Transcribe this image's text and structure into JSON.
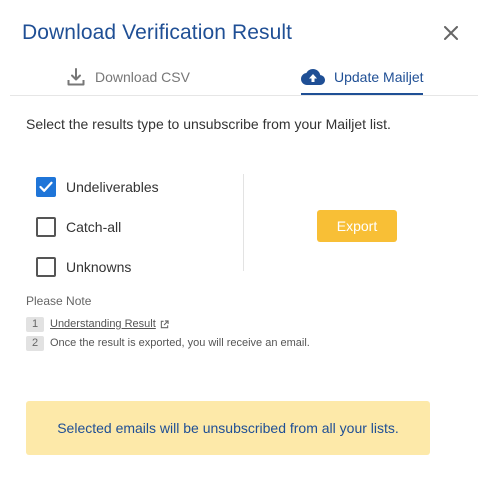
{
  "dialog": {
    "title": "Download Verification Result",
    "close_icon": "close-icon"
  },
  "tabs": [
    {
      "label": "Download CSV",
      "icon": "download-icon",
      "active": false
    },
    {
      "label": "Update Mailjet",
      "icon": "cloud-upload-icon",
      "active": true
    }
  ],
  "instruction": "Select the results type to unsubscribe from your Mailjet list.",
  "options": [
    {
      "label": "Undeliverables",
      "checked": true
    },
    {
      "label": "Catch-all",
      "checked": false
    },
    {
      "label": "Unknowns",
      "checked": false
    }
  ],
  "export_label": "Export",
  "note": {
    "title": "Please Note",
    "items": [
      {
        "num": "1",
        "text": "Understanding Result",
        "icon": "external-link-icon"
      },
      {
        "num": "2",
        "text": "Once the result is exported, you will receive an email."
      }
    ]
  },
  "warning": "Selected emails will be unsubscribed from all your lists.",
  "colors": {
    "primary": "#1f4f95",
    "checkbox": "#1f75d8",
    "export_button": "#f8bf36",
    "warning_bg": "#fde9a9"
  }
}
